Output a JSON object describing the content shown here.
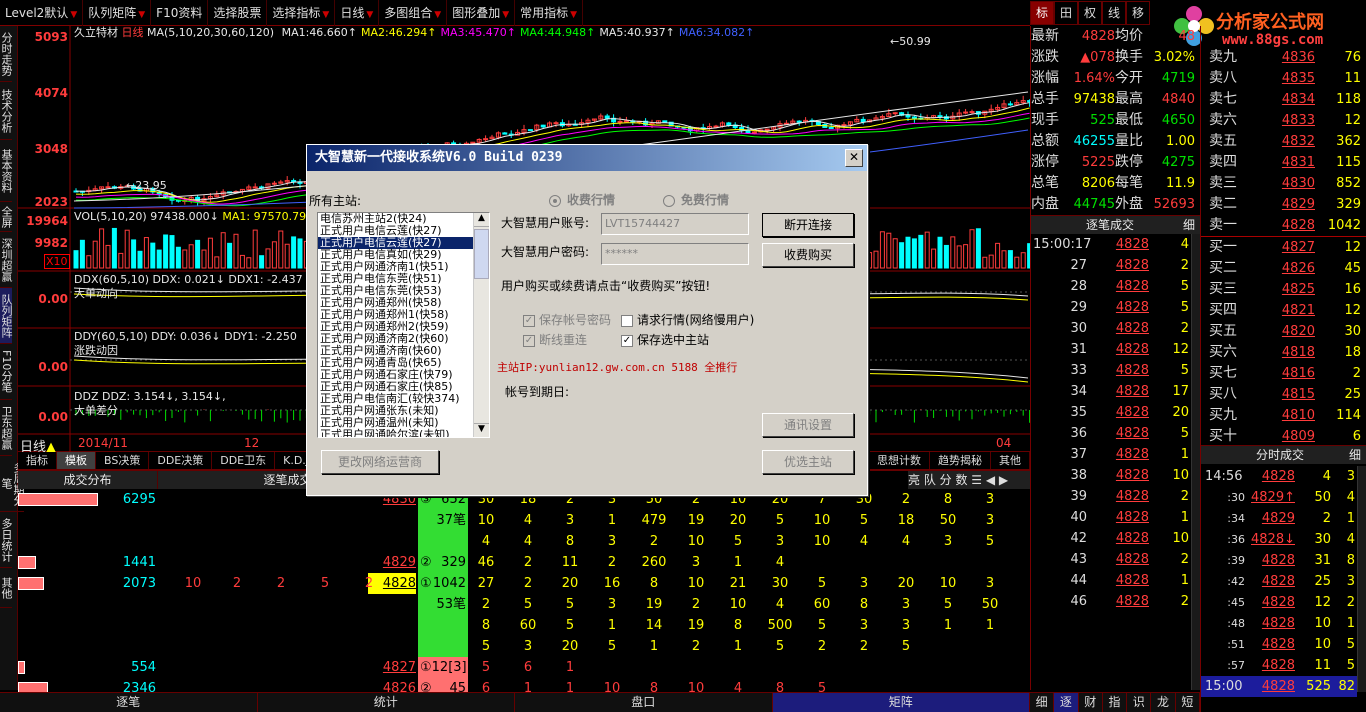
{
  "toolbar": [
    {
      "label": "Level2默认",
      "dd": true
    },
    {
      "label": "队列矩阵",
      "dd": true
    },
    {
      "label": "F10资料",
      "dd": false
    },
    {
      "label": "选择股票",
      "dd": false
    },
    {
      "label": "选择指标",
      "dd": true
    },
    {
      "label": "日线",
      "dd": true
    },
    {
      "label": "多图组合",
      "dd": true
    },
    {
      "label": "图形叠加",
      "dd": true
    },
    {
      "label": "常用指标",
      "dd": true
    }
  ],
  "left_tabs": [
    "分时走势",
    "技术分析",
    "基本资料",
    "全屏",
    "深圳超赢",
    "队列矩阵",
    "F10分笔",
    "卫东超赢",
    "多周期分笔",
    "多日统计",
    "其他"
  ],
  "chart": {
    "stock": "久立特材",
    "period": "日线",
    "ma_label": "MA(5,10,20,30,60,120)",
    "ma": [
      {
        "n": "MA1:",
        "v": "46.660↑",
        "color": "#e8e8e8"
      },
      {
        "n": "MA2:",
        "v": "46.294↑",
        "color": "#ffff00"
      },
      {
        "n": "MA3:",
        "v": "45.470↑",
        "color": "#ff00ff"
      },
      {
        "n": "MA4:",
        "v": "44.948↑",
        "color": "#00ff00"
      },
      {
        "n": "MA5:",
        "v": "40.937↑",
        "color": "#e8e8e8"
      },
      {
        "n": "MA6:",
        "v": "34.082↑",
        "color": "#4060ff"
      }
    ],
    "price_axis": [
      "5093",
      "4074",
      "3048",
      "2023"
    ],
    "high_mark": "50.99",
    "low_mark": "23.95",
    "vol_label": "VOL(5,10,20)",
    "vol_val": "97438.000↓",
    "vol_ma1": "MA1: 97570.797",
    "vol_axis": [
      "19964",
      "9982"
    ],
    "vol_unit": "X10",
    "ddx_label": "DDX(60,5,10)",
    "ddx_vals": "DDX: 0.021↓ DDX1: -2.437",
    "ddx_name": "大单动向",
    "ddx_axis": "0.00",
    "ddy_label": "DDY(60,5,10)",
    "ddy_vals": "DDY: 0.036↓ DDY1: -2.250",
    "ddy_name": "涨跌动因",
    "ddy_axis": "0.00",
    "ddz_label": "DDZ",
    "ddz_vals": "DDZ: 3.154↓, 3.154↓,",
    "ddz_name": "大单差分",
    "ddz_axis": "0.00",
    "xaxis": [
      "日线",
      "2014/11",
      "12",
      "04"
    ]
  },
  "bottom_tabs": [
    "指标",
    "模板",
    "BS决策",
    "DDE决策",
    "DDE卫东",
    "K.D.J",
    "思想计数",
    "趋势揭秘",
    "其他"
  ],
  "bottom_headers": {
    "dist": "成交分布",
    "deal": "逐笔成交",
    "queue": "亮 队 分 数"
  },
  "dist_rows": [
    {
      "val": "6295",
      "price": "4830",
      "tag": "③",
      "vol": "652",
      "cells": [
        "30",
        "18",
        "2",
        "3",
        "50",
        "2",
        "10",
        "20",
        "7",
        "30",
        "2",
        "8",
        "3"
      ]
    },
    {
      "val": "",
      "price": "",
      "tag": "",
      "vol": "37笔",
      "cells": [
        "10",
        "4",
        "3",
        "1",
        "479",
        "19",
        "20",
        "5",
        "10",
        "5",
        "18",
        "50",
        "3"
      ]
    },
    {
      "val": "",
      "price": "",
      "tag": "",
      "vol": "",
      "cells": [
        "4",
        "4",
        "8",
        "3",
        "2",
        "10",
        "5",
        "3",
        "10",
        "4",
        "4",
        "3",
        "5"
      ]
    },
    {
      "val": "1441",
      "price": "4829",
      "tag": "②",
      "vol": "329",
      "cells": [
        "46",
        "2",
        "11",
        "2",
        "260",
        "3",
        "1",
        "4"
      ]
    },
    {
      "val": "2073",
      "price": "4828",
      "tag": "①",
      "vol": "1042",
      "cells": [
        "27",
        "2",
        "20",
        "16",
        "8",
        "10",
        "21",
        "30",
        "5",
        "3",
        "20",
        "10",
        "3"
      ]
    },
    {
      "val": "",
      "price": "",
      "tag": "",
      "vol": "53笔",
      "cells": [
        "2",
        "5",
        "5",
        "3",
        "19",
        "2",
        "10",
        "4",
        "60",
        "8",
        "3",
        "5",
        "50"
      ]
    },
    {
      "val": "",
      "price": "",
      "tag": "",
      "vol": "",
      "cells": [
        "8",
        "60",
        "5",
        "1",
        "14",
        "19",
        "8",
        "500",
        "5",
        "3",
        "3",
        "1",
        "1"
      ]
    },
    {
      "val": "",
      "price": "",
      "tag": "",
      "vol": "",
      "cells": [
        "5",
        "3",
        "20",
        "5",
        "1",
        "2",
        "1",
        "5",
        "2",
        "2",
        "5"
      ]
    },
    {
      "val": "554",
      "price": "4827",
      "tag": "①",
      "vol": "12[3]",
      "cells": [
        "5",
        "6",
        "1"
      ]
    },
    {
      "val": "2346",
      "price": "4826",
      "tag": "②",
      "vol": "45",
      "cells": [
        "6",
        "1",
        "1",
        "10",
        "8",
        "10",
        "4",
        "8",
        "5"
      ]
    }
  ],
  "deal_row": [
    "10",
    "2",
    "2",
    "5",
    "2"
  ],
  "status_tabs": [
    "逐笔",
    "统计",
    "盘口",
    "矩阵"
  ],
  "right_tabs": [
    "标",
    "田",
    "权",
    "线",
    "移"
  ],
  "quote": [
    {
      "l1": "最新",
      "v1": "4828",
      "l2": "均价",
      "v2": "48"
    },
    {
      "l1": "涨跌",
      "v1": "▲078",
      "l2": "换手",
      "v2": "3.02%"
    },
    {
      "l1": "涨幅",
      "v1": "1.64%",
      "l2": "今开",
      "v2": "4719"
    },
    {
      "l1": "总手",
      "v1": "97438",
      "l2": "最高",
      "v2": "4840"
    },
    {
      "l1": "现手",
      "v1": "525",
      "l2": "最低",
      "v2": "4650"
    },
    {
      "l1": "总额",
      "v1": "46255",
      "l2": "量比",
      "v2": "1.00"
    },
    {
      "l1": "涨停",
      "v1": "5225",
      "l2": "跌停",
      "v2": "4275"
    },
    {
      "l1": "总笔",
      "v1": "8206",
      "l2": "每笔",
      "v2": "11.9"
    },
    {
      "l1": "内盘",
      "v1": "44745",
      "l2": "外盘",
      "v2": "52693"
    }
  ],
  "deal_title": "逐笔成交",
  "deal_tab": "细",
  "deals": [
    {
      "t": "15:00:17",
      "p": "4828",
      "v": "4"
    },
    {
      "t": "27",
      "p": "4828",
      "v": "2"
    },
    {
      "t": "28",
      "p": "4828",
      "v": "5"
    },
    {
      "t": "29",
      "p": "4828",
      "v": "5"
    },
    {
      "t": "30",
      "p": "4828",
      "v": "2"
    },
    {
      "t": "31",
      "p": "4828",
      "v": "12"
    },
    {
      "t": "33",
      "p": "4828",
      "v": "5"
    },
    {
      "t": "34",
      "p": "4828",
      "v": "17"
    },
    {
      "t": "35",
      "p": "4828",
      "v": "20"
    },
    {
      "t": "36",
      "p": "4828",
      "v": "5"
    },
    {
      "t": "37",
      "p": "4828",
      "v": "1"
    },
    {
      "t": "38",
      "p": "4828",
      "v": "10"
    },
    {
      "t": "39",
      "p": "4828",
      "v": "2"
    },
    {
      "t": "40",
      "p": "4828",
      "v": "1"
    },
    {
      "t": "42",
      "p": "4828",
      "v": "10"
    },
    {
      "t": "43",
      "p": "4828",
      "v": "2"
    },
    {
      "t": "44",
      "p": "4828",
      "v": "1"
    },
    {
      "t": "46",
      "p": "4828",
      "v": "2"
    }
  ],
  "sells": [
    {
      "l": "卖九",
      "p": "4836",
      "v": "76"
    },
    {
      "l": "卖八",
      "p": "4835",
      "v": "11"
    },
    {
      "l": "卖七",
      "p": "4834",
      "v": "118"
    },
    {
      "l": "卖六",
      "p": "4833",
      "v": "12"
    },
    {
      "l": "卖五",
      "p": "4832",
      "v": "362"
    },
    {
      "l": "卖四",
      "p": "4831",
      "v": "115"
    },
    {
      "l": "卖三",
      "p": "4830",
      "v": "852"
    },
    {
      "l": "卖二",
      "p": "4829",
      "v": "329"
    },
    {
      "l": "卖一",
      "p": "4828",
      "v": "1042"
    }
  ],
  "buys": [
    {
      "l": "买一",
      "p": "4827",
      "v": "12"
    },
    {
      "l": "买二",
      "p": "4826",
      "v": "45"
    },
    {
      "l": "买三",
      "p": "4825",
      "v": "16"
    },
    {
      "l": "买四",
      "p": "4821",
      "v": "12"
    },
    {
      "l": "买五",
      "p": "4820",
      "v": "30"
    },
    {
      "l": "买六",
      "p": "4818",
      "v": "18"
    },
    {
      "l": "买七",
      "p": "4816",
      "v": "2"
    },
    {
      "l": "买八",
      "p": "4815",
      "v": "25"
    },
    {
      "l": "买九",
      "p": "4810",
      "v": "114"
    },
    {
      "l": "买十",
      "p": "4809",
      "v": "6"
    }
  ],
  "tick_title": "分时成交",
  "tick_tab": "细",
  "ticks": [
    {
      "t": "14:56",
      "p": "4828",
      "v": "4",
      "n": "3"
    },
    {
      "t": ":30",
      "p": "4829↑",
      "v": "50",
      "n": "4"
    },
    {
      "t": ":34",
      "p": "4829",
      "v": "2",
      "n": "1"
    },
    {
      "t": ":36",
      "p": "4828↓",
      "v": "30",
      "n": "4"
    },
    {
      "t": ":39",
      "p": "4828",
      "v": "31",
      "n": "8"
    },
    {
      "t": ":42",
      "p": "4828",
      "v": "25",
      "n": "3"
    },
    {
      "t": ":45",
      "p": "4828",
      "v": "12",
      "n": "2"
    },
    {
      "t": ":48",
      "p": "4828",
      "v": "10",
      "n": "1"
    },
    {
      "t": ":51",
      "p": "4828",
      "v": "10",
      "n": "5"
    },
    {
      "t": ":57",
      "p": "4828",
      "v": "11",
      "n": "5"
    },
    {
      "t": "15:00",
      "p": "4828",
      "v": "525",
      "n": "82"
    }
  ],
  "right_bottom_tabs": [
    "细",
    "逐",
    "财",
    "指",
    "识",
    "龙",
    "短"
  ],
  "watermark": {
    "title": "分析家公式网",
    "url": "www.88gs.com"
  },
  "dialog": {
    "title": "大智慧新一代接收系统V6.0 Build 0239",
    "all_servers": "所有主站:",
    "servers": [
      "电信苏州主站2(快24)",
      "正式用户电信云莲(快27)",
      "正式用户电信云莲(快27)",
      "正式用户电信真如(快29)",
      "正式用户网通济南1(快51)",
      "正式用户电信东莞(快51)",
      "正式用户电信东莞(快53)",
      "正式用户网通郑州(快58)",
      "正式用户网通郑州1(快58)",
      "正式用户网通郑州2(快59)",
      "正式用户网通济南2(快60)",
      "正式用户网通济南(快60)",
      "正式用户网通青岛(快65)",
      "正式用户网通石家庄(快79)",
      "正式用户网通石家庄(快85)",
      "正式用户电信南汇(较快374)",
      "正式用户网通张东(未知)",
      "正式用户网通温州(未知)",
      "正式用户网通哈尔滨(未知)"
    ],
    "selected": 2,
    "radio_paid": "收费行情",
    "radio_free": "免费行情",
    "account_label": "大智慧用户账号:",
    "account_value": "LVT15744427",
    "password_label": "大智慧用户密码:",
    "password_value": "******",
    "btn_disconnect": "断开连接",
    "btn_buy": "收费购买",
    "hint": "用户购买或续费请点击“收费购买”按钮!",
    "chk_save_account": "保存帐号密码",
    "chk_request": "请求行情(网络慢用户)",
    "chk_reconnect": "断线重连",
    "chk_save_server": "保存选中主站",
    "server_ip": "主站IP:yunlian12.gw.com.cn 5188 全推行",
    "expire": "帐号到期日:",
    "btn_comm": "通讯设置",
    "btn_change_isp": "更改网络运营商",
    "btn_best": "优选主站"
  },
  "colors": {
    "up": "#ff3c3c",
    "down": "#00e000",
    "title": "#0a246a"
  }
}
